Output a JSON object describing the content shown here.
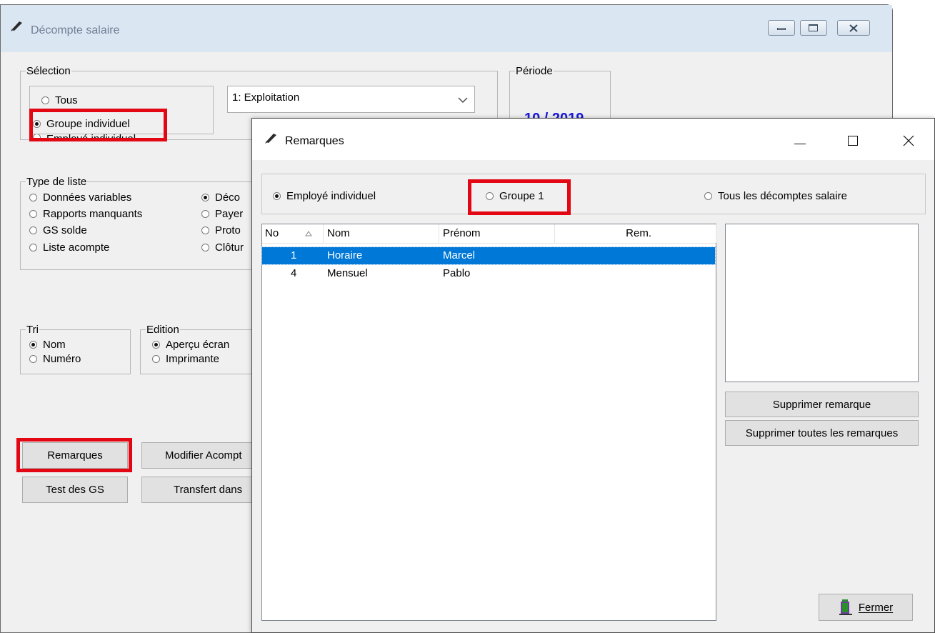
{
  "main_window": {
    "title": "Décompte salaire",
    "selection": {
      "legend": "Sélection",
      "options": [
        "Tous",
        "Groupe individuel",
        "Employé individuel"
      ],
      "selected": "Groupe individuel",
      "group_value": "1: Exploitation"
    },
    "periode": {
      "legend": "Période",
      "value": "10 / 2019"
    },
    "type_liste": {
      "legend": "Type de liste",
      "col1": [
        "Données variables",
        "Rapports manquants",
        "GS solde",
        "Liste acompte"
      ],
      "col2": [
        "Déco",
        "Payer",
        "Proto",
        "Clôtur"
      ],
      "selected": "Déco"
    },
    "tri": {
      "legend": "Tri",
      "options": [
        "Nom",
        "Numéro"
      ],
      "selected": "Nom"
    },
    "edition": {
      "legend": "Edition",
      "options": [
        "Aperçu écran",
        "Imprimante"
      ],
      "selected": "Aperçu écran"
    },
    "buttons": {
      "remarques": "Remarques",
      "modifier_acompte": "Modifier Acompt",
      "test_gs": "Test des GS",
      "transfert": "Transfert dans"
    }
  },
  "dialog": {
    "title": "Remarques",
    "scope_options": [
      "Employé individuel",
      "Groupe 1",
      "Tous les décomptes salaire"
    ],
    "scope_selected": "Employé individuel",
    "columns": [
      "No",
      "Nom",
      "Prénom",
      "Rem."
    ],
    "rows": [
      {
        "no": "1",
        "nom": "Horaire",
        "prenom": "Marcel",
        "rem": "",
        "selected": true
      },
      {
        "no": "4",
        "nom": "Mensuel",
        "prenom": "Pablo",
        "rem": "",
        "selected": false
      }
    ],
    "buttons": {
      "supprimer": "Supprimer remarque",
      "supprimer_toutes": "Supprimer toutes les remarques",
      "fermer": "Fermer"
    }
  },
  "colors": {
    "highlight": "#e30613",
    "selection": "#0078d7",
    "periode": "#1a1adb"
  }
}
